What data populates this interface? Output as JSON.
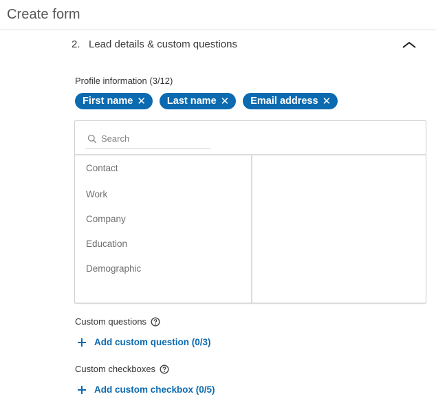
{
  "header": {
    "title": "Create form"
  },
  "section": {
    "number": "2.",
    "title": "Lead details & custom questions",
    "collapse_icon": "chevron-up-icon"
  },
  "profile": {
    "label": "Profile information (3/12)",
    "selected": [
      {
        "label": "First name",
        "remove_icon": "close-icon"
      },
      {
        "label": "Last name",
        "remove_icon": "close-icon"
      },
      {
        "label": "Email address",
        "remove_icon": "close-icon"
      }
    ],
    "search": {
      "placeholder": "Search",
      "value": "",
      "icon": "search-icon"
    },
    "categories": [
      "Contact",
      "Work",
      "Company",
      "Education",
      "Demographic"
    ]
  },
  "custom_questions": {
    "label": "Custom questions",
    "help_icon": "help-icon",
    "add_label": "Add custom question (0/3)"
  },
  "custom_checkboxes": {
    "label": "Custom checkboxes",
    "help_icon": "help-icon",
    "add_label": "Add custom checkbox (0/5)"
  },
  "colors": {
    "accent": "#0b6ab0",
    "pill_text": "#ffffff",
    "muted_text": "#6e6e6e"
  }
}
